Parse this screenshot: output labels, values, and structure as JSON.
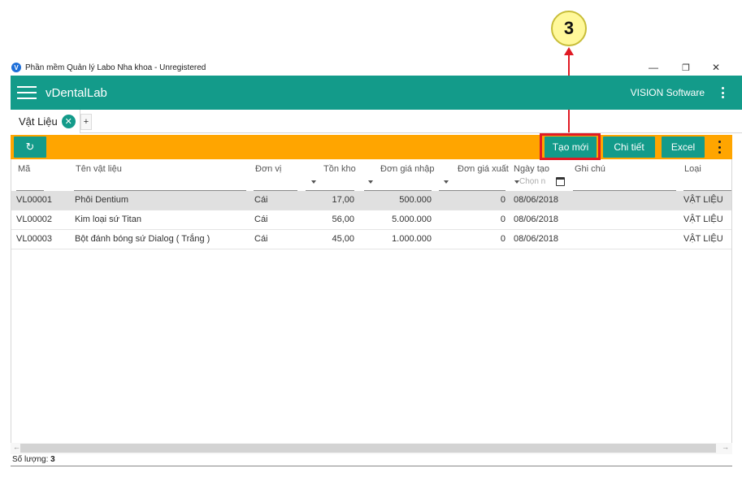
{
  "annotation": {
    "step": "3"
  },
  "window": {
    "title": "Phần mềm Quản lý Labo Nha khoa - Unregistered",
    "minimize": "—",
    "maximize": "❐",
    "close": "✕"
  },
  "appbar": {
    "title": "vDentalLab",
    "company": "VISION Software"
  },
  "tabs": [
    {
      "label": "Vật Liệu",
      "close": "✕"
    }
  ],
  "tab_add": "+",
  "toolbar": {
    "refresh": "↻",
    "create": "Tạo mới",
    "detail": "Chi tiết",
    "excel": "Excel"
  },
  "table": {
    "columns": [
      "Mã",
      "Tên vật liệu",
      "Đơn vị",
      "Tồn kho",
      "Đơn giá nhập",
      "Đơn giá xuất",
      "Ngày tạo",
      "Ghi chú",
      "Loại"
    ],
    "date_placeholder": "Chọn n",
    "rows": [
      {
        "code": "VL00001",
        "name": "Phôi Dentium",
        "unit": "Cái",
        "stock": "17,00",
        "buy": "500.000",
        "sell": "0",
        "date": "08/06/2018",
        "note": "",
        "type": "VẬT LIỆU"
      },
      {
        "code": "VL00002",
        "name": "Kim loại sứ Titan",
        "unit": "Cái",
        "stock": "56,00",
        "buy": "5.000.000",
        "sell": "0",
        "date": "08/06/2018",
        "note": "",
        "type": "VẬT LIỆU"
      },
      {
        "code": "VL00003",
        "name": "Bột đánh bóng sứ Dialog ( Trắng )",
        "unit": "Cái",
        "stock": "45,00",
        "buy": "1.000.000",
        "sell": "0",
        "date": "08/06/2018",
        "note": "",
        "type": "VẬT LIỆU"
      }
    ]
  },
  "footer": {
    "count_label": "Số lượng:",
    "count": "3"
  },
  "colors": {
    "primary": "#139b8a",
    "toolbar": "#ffa500",
    "highlight": "#e01b24",
    "callout": "#fff89a"
  }
}
